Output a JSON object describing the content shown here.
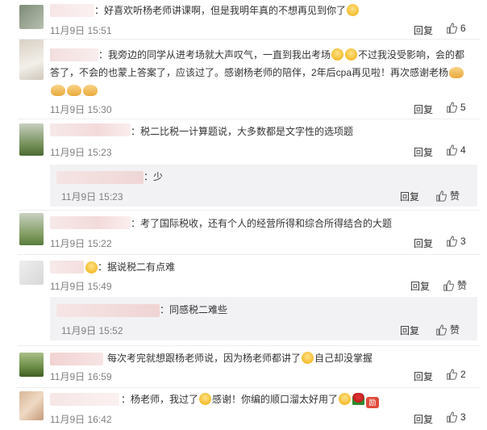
{
  "reply_label": "回复",
  "like_label": "赞",
  "comments": [
    {
      "text": "：好喜欢听杨老师讲课啊，但是我明年真的不想再见到你了",
      "time": "11月9日 15:51",
      "likes": "6"
    },
    {
      "text_line1": "：我旁边的同学从进考场就大声叹气，一直到我出考场",
      "text_line1b": "不过我没受影响，会的都",
      "text_line2": "答了，不会的也蒙上答案了，应该过了。感谢杨老师的陪伴，2年后cpa再见啦！再次感谢老杨",
      "time": "11月9日 15:30",
      "likes": "5"
    },
    {
      "text": "：税二比税一计算题说，大多数都是文字性的选项题",
      "time": "11月9日 15:23",
      "likes": "4",
      "sub": {
        "text": "：少",
        "time": "11月9日 15:23"
      }
    },
    {
      "text": "：考了国际税收，还有个人的经营所得和综合所得结合的大题",
      "time": "11月9日 15:22",
      "likes": "3"
    },
    {
      "text": "：据说税二有点难",
      "time": "11月9日 15:49",
      "sub": {
        "text": "：同感税二难些",
        "time": "11月9日 15:52"
      }
    },
    {
      "text": "每次考完就想跟杨老师说，因为杨老师都讲了",
      "text_b": "自己却没掌握",
      "time": "11月9日 16:59",
      "likes": "2"
    },
    {
      "text": "：杨老师，我过了",
      "text_b": "感谢！你编的顺口溜太好用了",
      "time": "11月9日 16:42",
      "likes": "3"
    }
  ]
}
